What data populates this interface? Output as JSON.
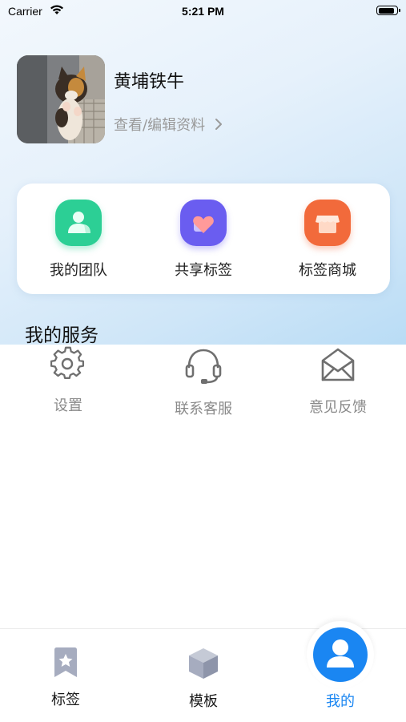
{
  "status": {
    "carrier": "Carrier",
    "time": "5:21 PM"
  },
  "profile": {
    "name": "黄埔铁牛",
    "edit_label": "查看/编辑资料"
  },
  "quick_actions": [
    {
      "label": "我的团队",
      "icon": "team-icon",
      "color": "#2ccf95"
    },
    {
      "label": "共享标签",
      "icon": "heart-share-icon",
      "color": "#6a5df0"
    },
    {
      "label": "标签商城",
      "icon": "store-icon",
      "color": "#f26a3b"
    }
  ],
  "services": {
    "title": "我的服务",
    "items": [
      {
        "label": "设置",
        "icon": "gear-icon"
      },
      {
        "label": "联系客服",
        "icon": "headset-icon"
      },
      {
        "label": "意见反馈",
        "icon": "mail-icon"
      }
    ]
  },
  "tabbar": {
    "items": [
      {
        "label": "标签",
        "icon": "bookmark-star-icon"
      },
      {
        "label": "模板",
        "icon": "cube-icon"
      },
      {
        "label": "我的",
        "icon": "user-icon",
        "active": true
      }
    ],
    "active_color": "#1a86f2"
  }
}
